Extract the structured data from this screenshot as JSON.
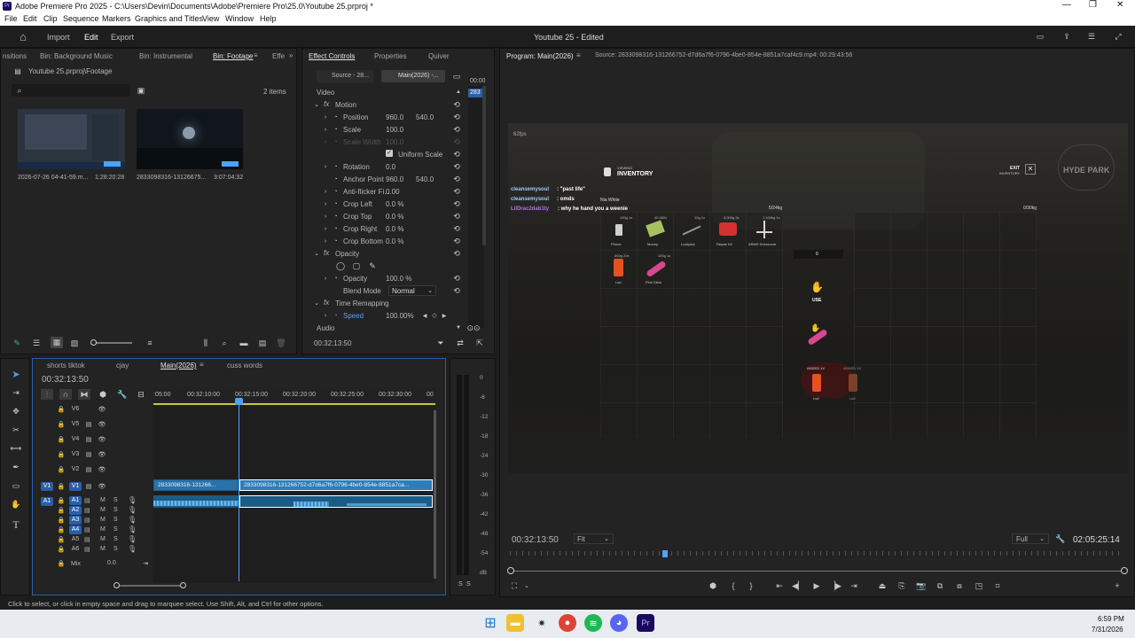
{
  "window": {
    "title": "Adobe Premiere Pro 2025 - C:\\Users\\Devin\\Documents\\Adobe\\Premiere Pro\\25.0\\Youtube 25.prproj *"
  },
  "menu": [
    "File",
    "Edit",
    "Clip",
    "Sequence",
    "Markers",
    "Graphics and Titles",
    "View",
    "Window",
    "Help"
  ],
  "topnav": {
    "tabs": [
      "Import",
      "Edit",
      "Export"
    ],
    "project_title": "Youtube 25 - Edited"
  },
  "project_panel": {
    "tabs": [
      "nsitions",
      "Bin: Background Music",
      "Bin: Instrumental",
      "Bin: Footage",
      "Effe"
    ],
    "path": "Youtube 25.prproj\\Footage",
    "count": "2 items",
    "items": [
      {
        "name": "2026-07-26 04-41-59.m...",
        "duration": "1:28:20:28"
      },
      {
        "name": "2833098316-13126675...",
        "duration": "3:07:04:32"
      }
    ]
  },
  "effect_controls": {
    "tabs": [
      "Effect Controls",
      "Properties",
      "Quiver"
    ],
    "source_tab": "Source - 28...",
    "main_tab": "Main(2026) -...",
    "playhead_label": "283",
    "time_top": "00:00",
    "video_label": "Video",
    "audio_label": "Audio",
    "timecode": "00:32:13:50",
    "rows": {
      "motion": "Motion",
      "position": "Position",
      "position_x": "960.0",
      "position_y": "540.0",
      "scale": "Scale",
      "scale_val": "100.0",
      "scale_width": "Scale Width",
      "scale_width_val": "100.0",
      "uniform_scale": "Uniform Scale",
      "rotation": "Rotation",
      "rotation_val": "0.0",
      "anchor": "Anchor Point",
      "anchor_x": "960.0",
      "anchor_y": "540.0",
      "antiflicker": "Anti-flicker Fi...",
      "antiflicker_val": "0.00",
      "crop_left": "Crop Left",
      "crop_left_val": "0.0 %",
      "crop_top": "Crop Top",
      "crop_top_val": "0.0 %",
      "crop_right": "Crop Right",
      "crop_right_val": "0.0 %",
      "crop_bottom": "Crop Bottom",
      "crop_bottom_val": "0.0 %",
      "opacity_group": "Opacity",
      "opacity": "Opacity",
      "opacity_val": "100.0 %",
      "blend_mode": "Blend Mode",
      "blend_mode_val": "Normal",
      "time_remap": "Time Remapping",
      "speed": "Speed",
      "speed_val": "100.00%"
    }
  },
  "program_monitor": {
    "title": "Program: Main(2026)",
    "source_info": "Source: 2833098316-131266752-d7d6a7f6-0796-4be0-854e-8851a7caf4c9.mp4: 00:29:43:56",
    "timecode": "00:32:13:50",
    "fit": "Fit",
    "full": "Full",
    "duration": "02:05:25:14",
    "playhead_fraction": 0.253
  },
  "game_frame": {
    "fps": "62fps",
    "viewing": "VIEWING",
    "inventory": "INVENTORY",
    "exit": "EXIT",
    "exit_sub": "INVENTORY",
    "logo": "HYDE PARK",
    "chat": [
      {
        "user": "cleansemysoul",
        "msg": ": \"past life\"",
        "color": "#9ec8ff"
      },
      {
        "user": "cleansemysoul",
        "msg": ": omds",
        "color": "#9ec8ff"
      },
      {
        "user": "LilDrac2dab1ty",
        "msg": ": why he hand you a weenie",
        "color": "#b070ff"
      }
    ],
    "nametag": "Nia White",
    "weight_left": "5/24kg",
    "weight_right": "0/30kg",
    "slots": [
      {
        "name": "Phone",
        "weight": "100g 1x",
        "color": "#cfcfcf"
      },
      {
        "name": "Money",
        "weight": "40,460x",
        "color": "#a8c060"
      },
      {
        "name": "Lockpick",
        "weight": "10g 1x",
        "color": "#9a9a9a"
      },
      {
        "name": "Repair Kit",
        "weight": "3,000g 3x",
        "color": "#d83030"
      },
      {
        "name": "ARMS Driveroom",
        "weight": "1,100kg 1x",
        "color": "#d8d8d8"
      },
      {
        "name": "Lsd",
        "weight": "800g 20x",
        "color": "#e85020"
      },
      {
        "name": "Pink Dildo",
        "weight": "100g 1x",
        "color": "#d84890"
      }
    ],
    "qty": "0",
    "use": "USE",
    "added": [
      {
        "label": "ADDED 1X",
        "name": "Lsd"
      },
      {
        "label": "ADDED 1X",
        "name": "Lsd"
      }
    ]
  },
  "timeline": {
    "tabs": [
      "shorts tiktok",
      "cjay",
      "Main(2026)",
      "cuss words"
    ],
    "timecode": "00:32:13:50",
    "ruler": [
      ":05:00",
      "00:32:10:00",
      "00:32:15:00",
      "00:32:20:00",
      "00:32:25:00",
      "00:32:30:00",
      "00"
    ],
    "video_tracks": [
      "V6",
      "V5",
      "V4",
      "V3",
      "V2",
      "V1"
    ],
    "audio_tracks": [
      "A1",
      "A2",
      "A3",
      "A4",
      "A5",
      "A6"
    ],
    "mix_label": "Mix",
    "mix_val": "0.0",
    "clip_video_1": "2833098316-131266...",
    "clip_video_2": "2833098316-131266752-d7d6a7f6-0796-4be0-854e-8851a7ca...",
    "meter_labels": [
      "0",
      "-6",
      "-12",
      "-18",
      "-24",
      "-30",
      "-36",
      "-42",
      "-48",
      "-54",
      "dB"
    ],
    "meter_bottom": [
      "S",
      "S"
    ]
  },
  "status_bar": "Click to select, or click in empty space and drag to marquee select. Use Shift, Alt, and Ctrl for other options.",
  "taskbar": {
    "time": "6:59 PM",
    "date": "7/31/2026"
  }
}
